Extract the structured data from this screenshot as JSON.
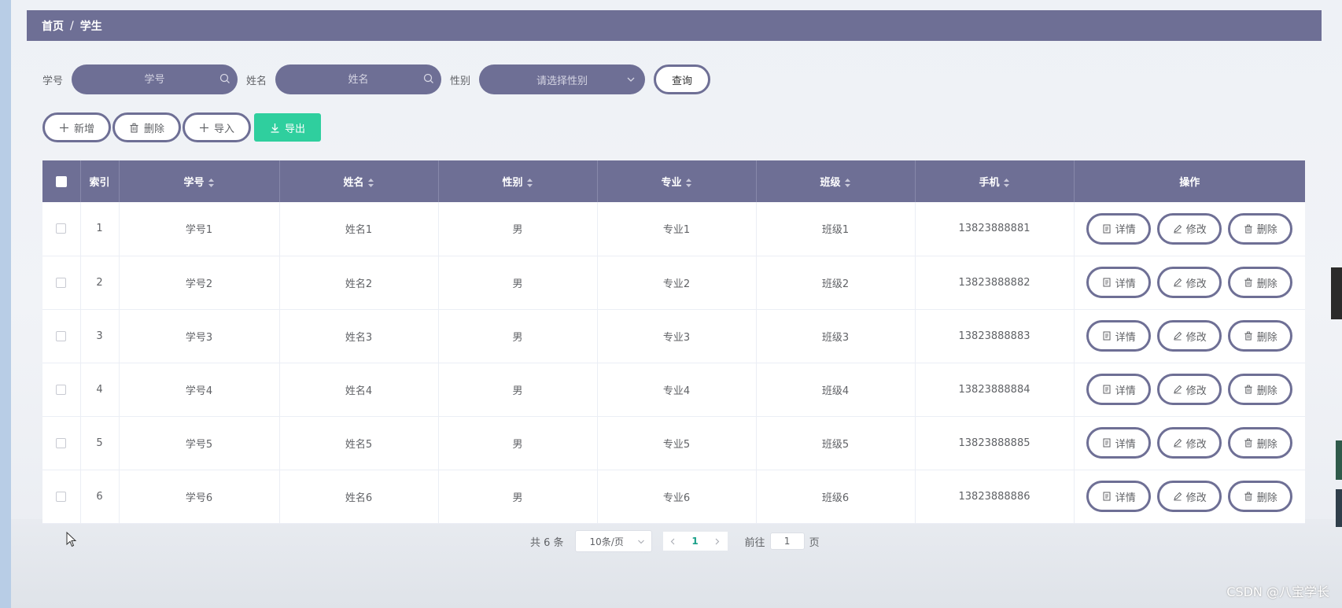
{
  "breadcrumb": {
    "home": "首页",
    "separator": "/",
    "current": "学生"
  },
  "search": {
    "id_label": "学号",
    "id_placeholder": "学号",
    "name_label": "姓名",
    "name_placeholder": "姓名",
    "gender_label": "性别",
    "gender_placeholder": "请选择性别",
    "query_label": "查询"
  },
  "actions": {
    "add": "新增",
    "delete": "删除",
    "import": "导入",
    "export": "导出"
  },
  "table": {
    "headers": {
      "index": "索引",
      "student_id": "学号",
      "name": "姓名",
      "gender": "性别",
      "major": "专业",
      "class": "班级",
      "phone": "手机",
      "ops": "操作"
    },
    "op_labels": {
      "detail": "详情",
      "edit": "修改",
      "delete": "删除"
    },
    "rows": [
      {
        "index": "1",
        "student_id": "学号1",
        "name": "姓名1",
        "gender": "男",
        "major": "专业1",
        "class": "班级1",
        "phone": "13823888881"
      },
      {
        "index": "2",
        "student_id": "学号2",
        "name": "姓名2",
        "gender": "男",
        "major": "专业2",
        "class": "班级2",
        "phone": "13823888882"
      },
      {
        "index": "3",
        "student_id": "学号3",
        "name": "姓名3",
        "gender": "男",
        "major": "专业3",
        "class": "班级3",
        "phone": "13823888883"
      },
      {
        "index": "4",
        "student_id": "学号4",
        "name": "姓名4",
        "gender": "男",
        "major": "专业4",
        "class": "班级4",
        "phone": "13823888884"
      },
      {
        "index": "5",
        "student_id": "学号5",
        "name": "姓名5",
        "gender": "男",
        "major": "专业5",
        "class": "班级5",
        "phone": "13823888885"
      },
      {
        "index": "6",
        "student_id": "学号6",
        "name": "姓名6",
        "gender": "男",
        "major": "专业6",
        "class": "班级6",
        "phone": "13823888886"
      }
    ]
  },
  "pagination": {
    "total": "共 6 条",
    "page_size": "10条/页",
    "current_page": "1",
    "goto_label": "前往",
    "goto_value": "1",
    "page_unit": "页"
  },
  "watermark": "CSDN @八宝学长",
  "colors": {
    "primary": "#6e6f95",
    "export": "#2fcf9e",
    "current_page": "#1aa089"
  }
}
